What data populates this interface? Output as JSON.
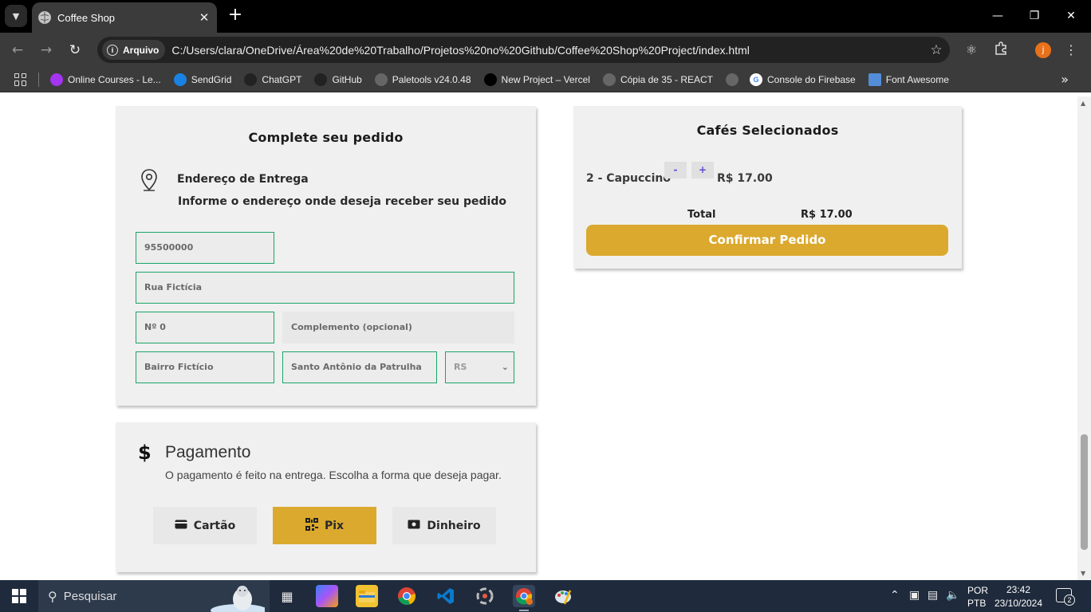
{
  "browser": {
    "tab_title": "Coffee Shop",
    "omnibox_label": "Arquivo",
    "url": "C:/Users/clara/OneDrive/Área%20de%20Trabalho/Projetos%20no%20Github/Coffee%20Shop%20Project/index.html",
    "profile_initial": "j",
    "bookmarks": [
      {
        "label": "Online Courses - Le...",
        "icon": "udemy-icon",
        "color": "#a435f0"
      },
      {
        "label": "SendGrid",
        "icon": "sendgrid-icon",
        "color": "#1a82e2"
      },
      {
        "label": "ChatGPT",
        "icon": "chatgpt-icon",
        "color": "#222222"
      },
      {
        "label": "GitHub",
        "icon": "github-icon",
        "color": "#222222"
      },
      {
        "label": "Paletools v24.0.48",
        "icon": "globe-icon",
        "color": "#666666"
      },
      {
        "label": "New Project – Vercel",
        "icon": "vercel-icon",
        "color": "#000000"
      },
      {
        "label": "Cópia de 35 - REACT",
        "icon": "globe-icon",
        "color": "#666666"
      },
      {
        "label": "",
        "icon": "globe-icon",
        "color": "#666666"
      },
      {
        "label": "Console do Firebase",
        "icon": "google-icon",
        "color": "#ffffff"
      },
      {
        "label": "Font Awesome",
        "icon": "flag-icon",
        "color": "#538dd7"
      }
    ]
  },
  "order": {
    "title": "Complete seu pedido",
    "address_title": "Endereço de Entrega",
    "address_subtitle": "Informe o endereço onde deseja receber seu pedido",
    "fields": {
      "cep": "95500000",
      "street": "Rua Fictícia",
      "number": "Nº 0",
      "complement": "Complemento (opcional)",
      "neighborhood": "Bairro Fictício",
      "city": "Santo Antônio da Patrulha",
      "state": "RS"
    }
  },
  "payment": {
    "title": "Pagamento",
    "subtitle": "O pagamento é feito na entrega. Escolha a forma que deseja pagar.",
    "options": [
      {
        "label": "Cartão",
        "icon": "credit-card-icon"
      },
      {
        "label": "Pix",
        "icon": "qrcode-icon"
      },
      {
        "label": "Dinheiro",
        "icon": "money-bill-icon"
      }
    ],
    "selected": "Pix",
    "accent_color": "#dba92e"
  },
  "cart": {
    "title": "Cafés Selecionados",
    "items": [
      {
        "label": "2 - Capuccino",
        "price": "R$ 17.00"
      }
    ],
    "decrement_label": "-",
    "increment_label": "+",
    "total_label": "Total",
    "total_value": "R$ 17.00",
    "confirm_label": "Confirmar Pedido"
  },
  "taskbar": {
    "search_placeholder": "Pesquisar",
    "language": "POR",
    "layout": "PTB",
    "time": "23:42",
    "date": "23/10/2024",
    "notifications": "2"
  }
}
